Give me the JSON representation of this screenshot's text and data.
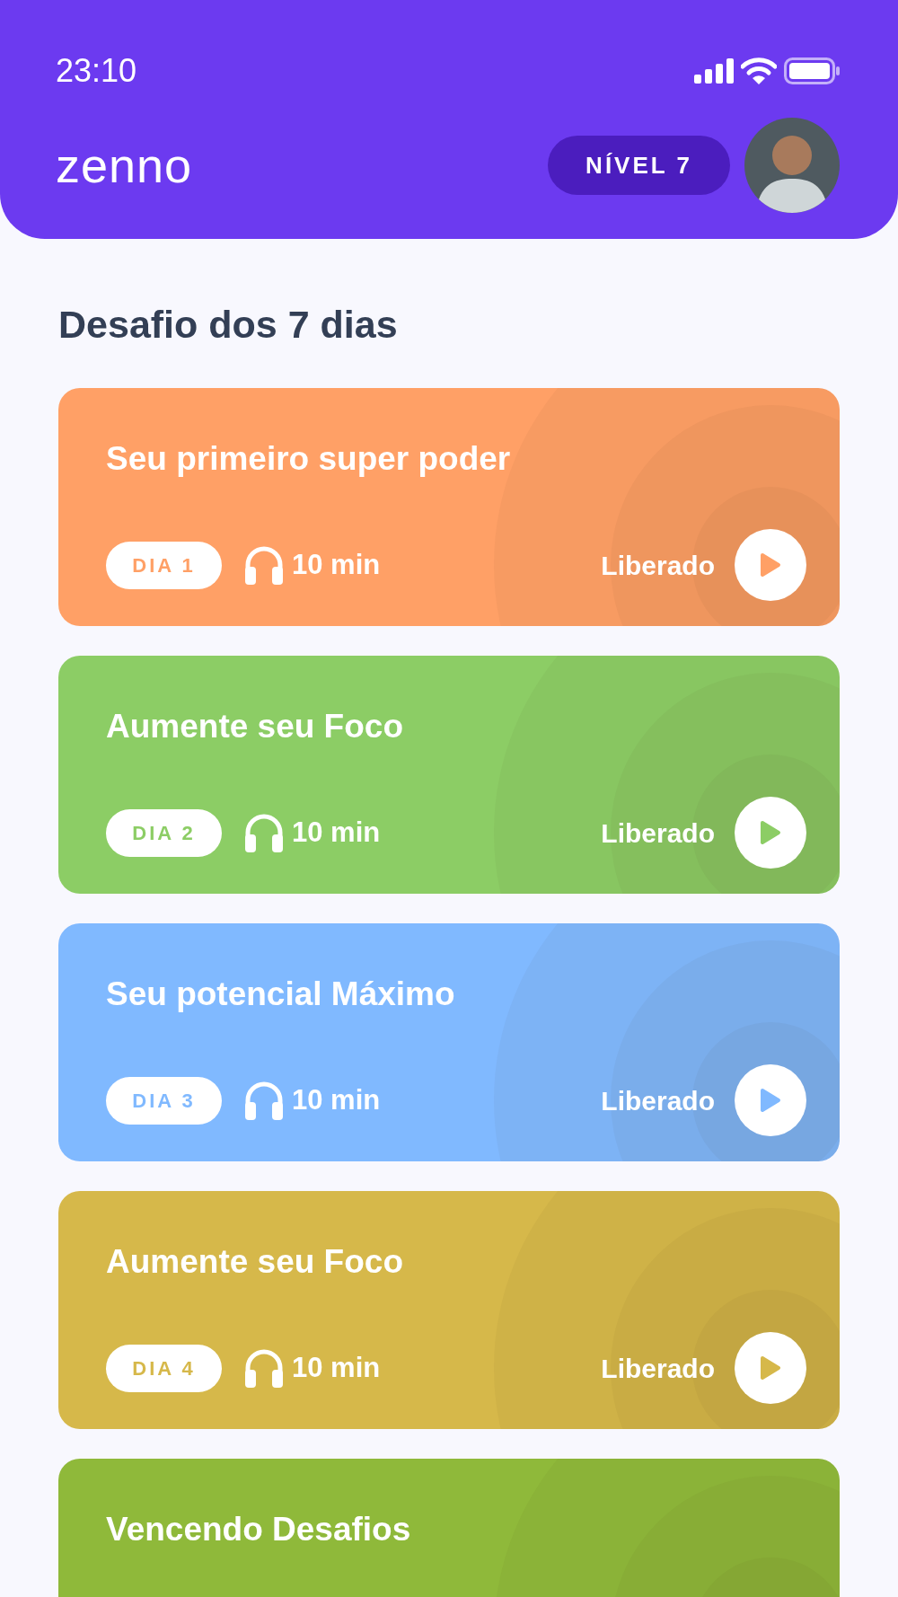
{
  "status_bar": {
    "time": "23:10"
  },
  "header": {
    "logo": "zenno",
    "level_badge": "NÍVEL 7"
  },
  "section_title": "Desafio dos 7 dias",
  "cards": [
    {
      "title": "Seu primeiro super poder",
      "day": "DIA 1",
      "duration": "10 min",
      "status": "Liberado",
      "color": "#ffa066"
    },
    {
      "title": "Aumente seu Foco",
      "day": "DIA 2",
      "duration": "10 min",
      "status": "Liberado",
      "color": "#8ccd65"
    },
    {
      "title": "Seu potencial Máximo",
      "day": "DIA 3",
      "duration": "10 min",
      "status": "Liberado",
      "color": "#80b9ff"
    },
    {
      "title": "Aumente seu Foco",
      "day": "DIA 4",
      "duration": "10 min",
      "status": "Liberado",
      "color": "#d6b84a"
    },
    {
      "title": "Vencendo Desafios",
      "color": "#8fb93a"
    }
  ]
}
